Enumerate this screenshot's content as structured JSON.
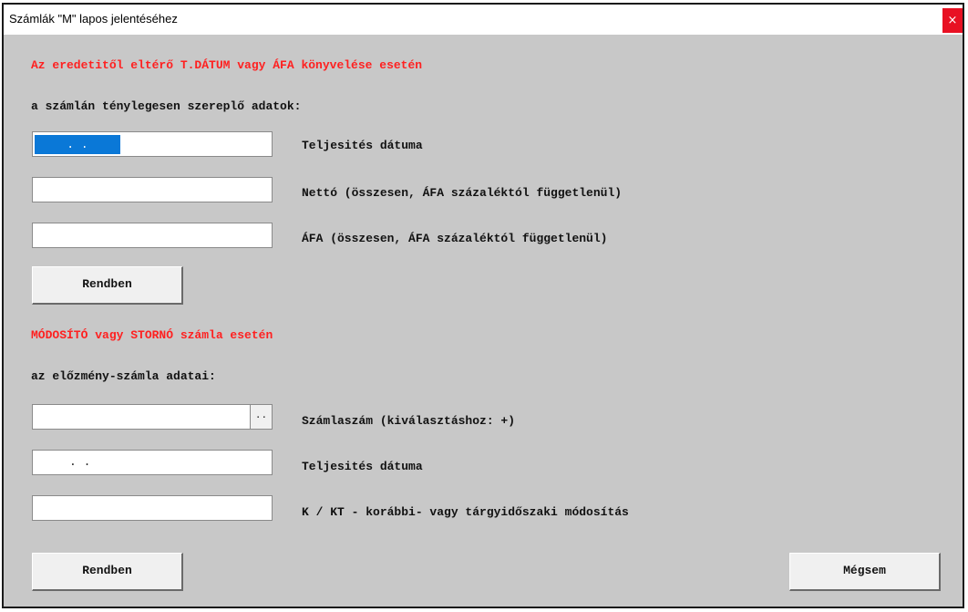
{
  "window": {
    "title": "Számlák \"M\" lapos jelentéséhez",
    "close_glyph": "×"
  },
  "section1": {
    "heading": "Az eredetitől eltérő T.DÁTUM vagy ÁFA könyvelése esetén",
    "subheading": "a számlán ténylegesen szereplő adatok:",
    "date_field": {
      "value": ". .",
      "selected": true
    },
    "date_label": "Teljesités dátuma",
    "net_field": {
      "value": ""
    },
    "net_label": "Nettó (összesen, ÁFA százaléktól függetlenül)",
    "vat_field": {
      "value": ""
    },
    "vat_label": "ÁFA (összesen, ÁFA százaléktól függetlenül)",
    "ok_label": "Rendben"
  },
  "section2": {
    "heading": "MÓDOSÍTÓ vagy STORNÓ számla esetén",
    "subheading": "az előzmény-számla adatai:",
    "invoice_field": {
      "value": "",
      "browse_label": ".."
    },
    "invoice_label": "Számlaszám (kiválasztáshoz: +)",
    "date_field": {
      "value": ". ."
    },
    "date_label": "Teljesités dátuma",
    "mod_field": {
      "value": ""
    },
    "mod_label": "K / KT - korábbi- vagy tárgyidőszaki módosítás",
    "ok_label": "Rendben",
    "cancel_label": "Mégsem"
  },
  "colors": {
    "heading_red": "#ff2020",
    "selection_blue": "#0a78d7",
    "background": "#c8c8c8"
  }
}
